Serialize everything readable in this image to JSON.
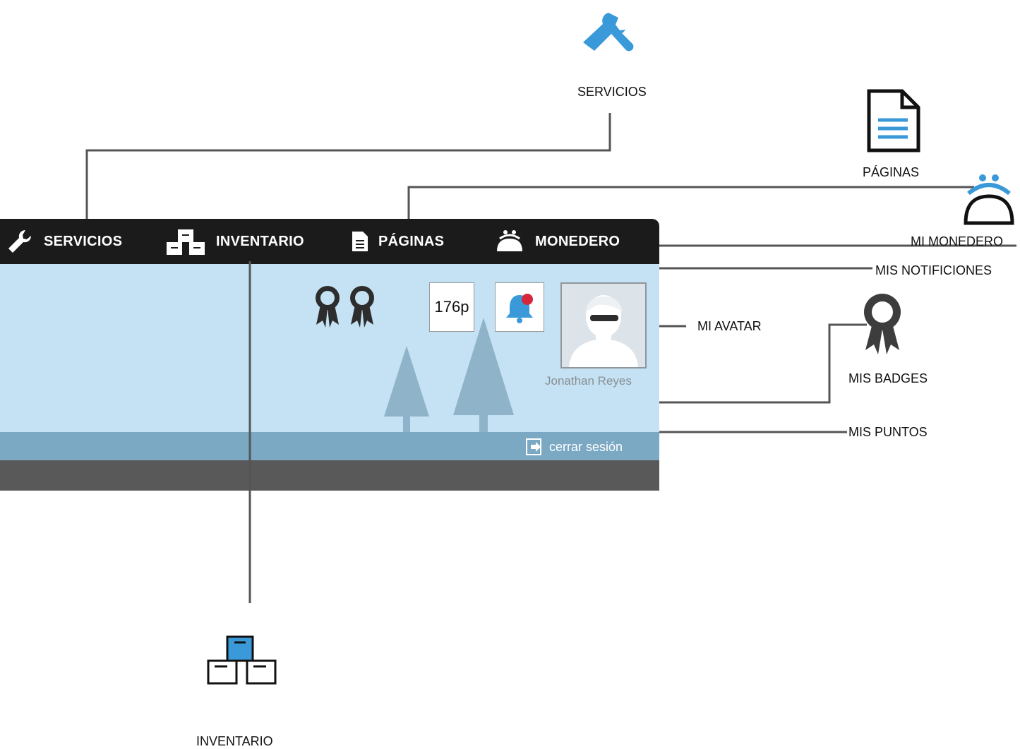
{
  "navbar": {
    "items": [
      {
        "label": "SERVICIOS",
        "icon": "wrench-icon"
      },
      {
        "label": "INVENTARIO",
        "icon": "boxes-icon"
      },
      {
        "label": "PÁGINAS",
        "icon": "document-icon"
      },
      {
        "label": "MONEDERO",
        "icon": "coin-purse-icon"
      }
    ]
  },
  "header": {
    "points": "176p",
    "user_name": "Jonathan Reyes",
    "logout_label": "cerrar sesión"
  },
  "callouts": {
    "servicios": "SERVICIOS",
    "paginas": "PÁGINAS",
    "monedero": "MI MONEDERO",
    "notificaciones": "MIS NOTIFICIONES",
    "avatar": "MI AVATAR",
    "badges": "MIS BADGES",
    "puntos": "MIS PUNTOS",
    "inventario": "INVENTARIO"
  },
  "colors": {
    "accent": "#3a9ad9",
    "navbar": "#1b1b1b",
    "sky": "#c4e2f3",
    "ground": "#7ba9c4",
    "footer": "#595959",
    "notification_dot": "#d6263a"
  }
}
